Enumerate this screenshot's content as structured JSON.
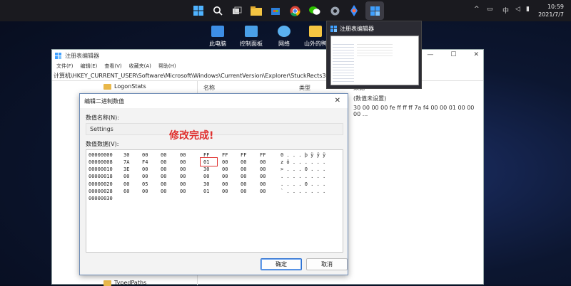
{
  "taskbar": {
    "icons": [
      "windows-start",
      "search",
      "task-view",
      "file-explorer",
      "store",
      "chrome",
      "wechat",
      "settings",
      "app-blue",
      "registry-editor"
    ],
    "tray_chevron": "^",
    "ime": "中",
    "clock_time": "10:59",
    "clock_date": "2021/7/7"
  },
  "desktop_icons": [
    "此电脑",
    "控制面板",
    "网络",
    "山外的鸭"
  ],
  "preview": {
    "title": "注册表编辑器"
  },
  "regedit": {
    "title": "注册表编辑器",
    "menu": [
      "文件(F)",
      "编辑(E)",
      "查看(V)",
      "收藏夹(A)",
      "帮助(H)"
    ],
    "address": "计算机\\HKEY_CURRENT_USER\\Software\\Microsoft\\Windows\\CurrentVersion\\Explorer\\StuckRects3",
    "tree_items": [
      "LogonStats",
      "TypedPaths"
    ],
    "columns": {
      "name": "名称",
      "type": "类型",
      "data": "数据"
    },
    "values": [
      "(数值未设置)",
      "30 00 00 00 fe ff ff ff 7a f4 00 00 01 00 00 00 ..."
    ]
  },
  "dialog": {
    "title": "编辑二进制数值",
    "name_label": "数值名称(N):",
    "name_value": "Settings",
    "data_label": "数值数据(V):",
    "ok": "确定",
    "cancel": "取消",
    "hex_rows": [
      {
        "addr": "00000000",
        "bytes": [
          "30",
          "00",
          "00",
          "00",
          "FF",
          "FF",
          "FF",
          "FF"
        ],
        "ascii": "0 . . . þ ÿ ÿ ÿ"
      },
      {
        "addr": "00000008",
        "bytes": [
          "7A",
          "F4",
          "00",
          "00",
          "01",
          "00",
          "00",
          "00"
        ],
        "ascii": "z ô . . . . . ."
      },
      {
        "addr": "00000010",
        "bytes": [
          "3E",
          "00",
          "00",
          "00",
          "30",
          "00",
          "00",
          "00"
        ],
        "ascii": "> . . . 0 . . ."
      },
      {
        "addr": "00000018",
        "bytes": [
          "00",
          "00",
          "00",
          "00",
          "00",
          "00",
          "00",
          "00"
        ],
        "ascii": ". . . . . . . ."
      },
      {
        "addr": "00000020",
        "bytes": [
          "00",
          "05",
          "00",
          "00",
          "30",
          "00",
          "00",
          "00"
        ],
        "ascii": ". . . . 0 . . ."
      },
      {
        "addr": "00000028",
        "bytes": [
          "60",
          "00",
          "00",
          "00",
          "01",
          "00",
          "00",
          "00"
        ],
        "ascii": "` . . . . . . ."
      },
      {
        "addr": "00000030",
        "bytes": [],
        "ascii": ""
      }
    ]
  },
  "annotation": "修改完成!"
}
